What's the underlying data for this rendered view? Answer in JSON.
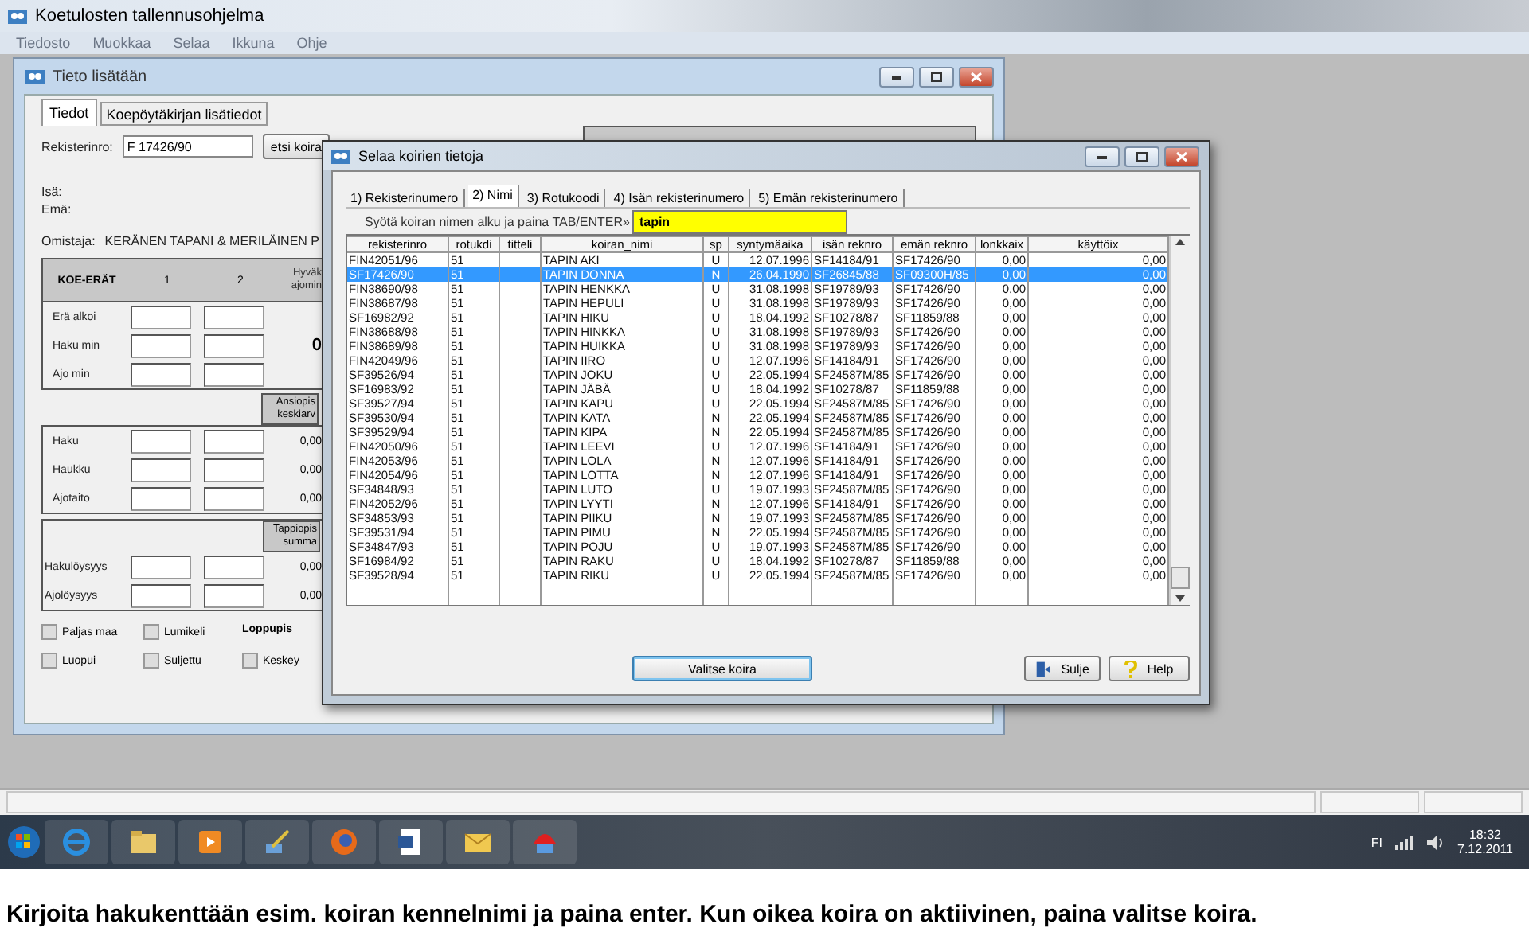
{
  "app": {
    "title": "Koetulosten tallennusohjelma",
    "menu": [
      "Tiedosto",
      "Muokkaa",
      "Selaa",
      "Ikkuna",
      "Ohje"
    ]
  },
  "form_window": {
    "title": "Tieto lisätään",
    "tabs": [
      {
        "label": "Tiedot",
        "selected": true
      },
      {
        "label": "Koepöytäkirjan lisätiedot",
        "selected": false
      }
    ],
    "reg_label": "Rekisterinro:",
    "reg_value": "F 17426/90",
    "find_button": "etsi koira",
    "sire_label": "Isä:",
    "dam_label": "Emä:",
    "owner_label": "Omistaja:",
    "owner": "KERÄNEN TAPANI & MERILÄINEN P",
    "trials": {
      "header": [
        "KOE-ERÄT",
        "1",
        "2"
      ],
      "side_header": [
        "Hyväk",
        "ajomin"
      ],
      "total": "0",
      "rows": [
        "Erä alkoi",
        "Haku min",
        "Ajo min"
      ]
    },
    "merit": {
      "header": [
        "Ansiopis",
        "keskiarv"
      ],
      "rows": [
        {
          "label": "Haku",
          "value": "0,00"
        },
        {
          "label": "Haukku",
          "value": "0,00"
        },
        {
          "label": "Ajotaito",
          "value": "0,00"
        }
      ]
    },
    "penalty": {
      "header": [
        "Tappiopis",
        "summa"
      ],
      "rows": [
        {
          "label": "Hakulöysyys",
          "value": "0,00"
        },
        {
          "label": "Ajolöysyys",
          "value": "0,00"
        }
      ]
    },
    "options": [
      {
        "kind": "checkbox",
        "label": "Paljas maa",
        "checked": false
      },
      {
        "kind": "checkbox",
        "label": "Lumikeli",
        "checked": false
      },
      {
        "kind": "heading",
        "label": "Loppupis"
      },
      {
        "kind": "checkbox",
        "label": "Luopui",
        "checked": false
      },
      {
        "kind": "checkbox",
        "label": "Suljettu",
        "checked": false
      },
      {
        "kind": "checkbox",
        "label": "Keskey",
        "checked": false
      }
    ]
  },
  "dialog": {
    "title": "Selaa koirien tietoja",
    "tabs": [
      {
        "label": "1) Rekisterinumero",
        "selected": false
      },
      {
        "label": "2) Nimi",
        "selected": true
      },
      {
        "label": "3) Rotukoodi",
        "selected": false
      },
      {
        "label": "4) Isän rekisterinumero",
        "selected": false
      },
      {
        "label": "5) Emän rekisterinumero",
        "selected": false
      }
    ],
    "search": {
      "label": "Syötä koiran nimen alku ja paina TAB/ENTER»",
      "value": "tapin"
    },
    "columns": [
      "rekisterinro",
      "rotukdi",
      "titteli",
      "koiran_nimi",
      "sp",
      "syntymäaika",
      "isän reknro",
      "emän reknro",
      "lonkkaix",
      "käyttöix"
    ],
    "rows": [
      {
        "selected": false,
        "reg": "FIN42051/96",
        "breed": "51",
        "name": "TAPIN AKI",
        "sex": "U",
        "born": "12.07.1996",
        "sire": "SF14184/91",
        "dam": "SF17426/90",
        "hip": "0,00",
        "use": "0,00"
      },
      {
        "selected": true,
        "reg": "SF17426/90",
        "breed": "51",
        "name": "TAPIN DONNA",
        "sex": "N",
        "born": "26.04.1990",
        "sire": "SF26845/88",
        "dam": "SF09300H/85",
        "hip": "0,00",
        "use": "0,00"
      },
      {
        "selected": false,
        "reg": "FIN38690/98",
        "breed": "51",
        "name": "TAPIN HENKKA",
        "sex": "U",
        "born": "31.08.1998",
        "sire": "SF19789/93",
        "dam": "SF17426/90",
        "hip": "0,00",
        "use": "0,00"
      },
      {
        "selected": false,
        "reg": "FIN38687/98",
        "breed": "51",
        "name": "TAPIN HEPULI",
        "sex": "U",
        "born": "31.08.1998",
        "sire": "SF19789/93",
        "dam": "SF17426/90",
        "hip": "0,00",
        "use": "0,00"
      },
      {
        "selected": false,
        "reg": "SF16982/92",
        "breed": "51",
        "name": "TAPIN HIKU",
        "sex": "U",
        "born": "18.04.1992",
        "sire": "SF10278/87",
        "dam": "SF11859/88",
        "hip": "0,00",
        "use": "0,00"
      },
      {
        "selected": false,
        "reg": "FIN38688/98",
        "breed": "51",
        "name": "TAPIN HINKKA",
        "sex": "U",
        "born": "31.08.1998",
        "sire": "SF19789/93",
        "dam": "SF17426/90",
        "hip": "0,00",
        "use": "0,00"
      },
      {
        "selected": false,
        "reg": "FIN38689/98",
        "breed": "51",
        "name": "TAPIN HUIKKA",
        "sex": "U",
        "born": "31.08.1998",
        "sire": "SF19789/93",
        "dam": "SF17426/90",
        "hip": "0,00",
        "use": "0,00"
      },
      {
        "selected": false,
        "reg": "FIN42049/96",
        "breed": "51",
        "name": "TAPIN IIRO",
        "sex": "U",
        "born": "12.07.1996",
        "sire": "SF14184/91",
        "dam": "SF17426/90",
        "hip": "0,00",
        "use": "0,00"
      },
      {
        "selected": false,
        "reg": "SF39526/94",
        "breed": "51",
        "name": "TAPIN JOKU",
        "sex": "U",
        "born": "22.05.1994",
        "sire": "SF24587M/85",
        "dam": "SF17426/90",
        "hip": "0,00",
        "use": "0,00"
      },
      {
        "selected": false,
        "reg": "SF16983/92",
        "breed": "51",
        "name": "TAPIN JÄBÄ",
        "sex": "U",
        "born": "18.04.1992",
        "sire": "SF10278/87",
        "dam": "SF11859/88",
        "hip": "0,00",
        "use": "0,00"
      },
      {
        "selected": false,
        "reg": "SF39527/94",
        "breed": "51",
        "name": "TAPIN KAPU",
        "sex": "U",
        "born": "22.05.1994",
        "sire": "SF24587M/85",
        "dam": "SF17426/90",
        "hip": "0,00",
        "use": "0,00"
      },
      {
        "selected": false,
        "reg": "SF39530/94",
        "breed": "51",
        "name": "TAPIN KATA",
        "sex": "N",
        "born": "22.05.1994",
        "sire": "SF24587M/85",
        "dam": "SF17426/90",
        "hip": "0,00",
        "use": "0,00"
      },
      {
        "selected": false,
        "reg": "SF39529/94",
        "breed": "51",
        "name": "TAPIN KIPA",
        "sex": "N",
        "born": "22.05.1994",
        "sire": "SF24587M/85",
        "dam": "SF17426/90",
        "hip": "0,00",
        "use": "0,00"
      },
      {
        "selected": false,
        "reg": "FIN42050/96",
        "breed": "51",
        "name": "TAPIN LEEVI",
        "sex": "U",
        "born": "12.07.1996",
        "sire": "SF14184/91",
        "dam": "SF17426/90",
        "hip": "0,00",
        "use": "0,00"
      },
      {
        "selected": false,
        "reg": "FIN42053/96",
        "breed": "51",
        "name": "TAPIN LOLA",
        "sex": "N",
        "born": "12.07.1996",
        "sire": "SF14184/91",
        "dam": "SF17426/90",
        "hip": "0,00",
        "use": "0,00"
      },
      {
        "selected": false,
        "reg": "FIN42054/96",
        "breed": "51",
        "name": "TAPIN LOTTA",
        "sex": "N",
        "born": "12.07.1996",
        "sire": "SF14184/91",
        "dam": "SF17426/90",
        "hip": "0,00",
        "use": "0,00"
      },
      {
        "selected": false,
        "reg": "SF34848/93",
        "breed": "51",
        "name": "TAPIN LUTO",
        "sex": "U",
        "born": "19.07.1993",
        "sire": "SF24587M/85",
        "dam": "SF17426/90",
        "hip": "0,00",
        "use": "0,00"
      },
      {
        "selected": false,
        "reg": "FIN42052/96",
        "breed": "51",
        "name": "TAPIN LYYTI",
        "sex": "N",
        "born": "12.07.1996",
        "sire": "SF14184/91",
        "dam": "SF17426/90",
        "hip": "0,00",
        "use": "0,00"
      },
      {
        "selected": false,
        "reg": "SF34853/93",
        "breed": "51",
        "name": "TAPIN PIIKU",
        "sex": "N",
        "born": "19.07.1993",
        "sire": "SF24587M/85",
        "dam": "SF17426/90",
        "hip": "0,00",
        "use": "0,00"
      },
      {
        "selected": false,
        "reg": "SF39531/94",
        "breed": "51",
        "name": "TAPIN PIMU",
        "sex": "N",
        "born": "22.05.1994",
        "sire": "SF24587M/85",
        "dam": "SF17426/90",
        "hip": "0,00",
        "use": "0,00"
      },
      {
        "selected": false,
        "reg": "SF34847/93",
        "breed": "51",
        "name": "TAPIN POJU",
        "sex": "U",
        "born": "19.07.1993",
        "sire": "SF24587M/85",
        "dam": "SF17426/90",
        "hip": "0,00",
        "use": "0,00"
      },
      {
        "selected": false,
        "reg": "SF16984/92",
        "breed": "51",
        "name": "TAPIN RAKU",
        "sex": "U",
        "born": "18.04.1992",
        "sire": "SF10278/87",
        "dam": "SF11859/88",
        "hip": "0,00",
        "use": "0,00"
      },
      {
        "selected": false,
        "reg": "SF39528/94",
        "breed": "51",
        "name": "TAPIN RIKU",
        "sex": "U",
        "born": "22.05.1994",
        "sire": "SF24587M/85",
        "dam": "SF17426/90",
        "hip": "0,00",
        "use": "0,00"
      }
    ],
    "buttons": [
      {
        "kind": "select",
        "label": "Valitse koira"
      },
      {
        "kind": "close",
        "label": "Sulje"
      },
      {
        "kind": "help",
        "label": "Help"
      }
    ]
  },
  "taskbar": {
    "apps": [
      {
        "kind": "start"
      },
      {
        "kind": "browser"
      },
      {
        "kind": "folder"
      },
      {
        "kind": "media"
      },
      {
        "kind": "paint"
      },
      {
        "kind": "firefox"
      },
      {
        "kind": "word"
      },
      {
        "kind": "mail"
      },
      {
        "kind": "smurf"
      }
    ],
    "language": "FI",
    "time": "18:32",
    "date": "7.12.2011"
  },
  "caption": "Kirjoita hakukenttään esim. koiran kennelnimi ja paina enter. Kun oikea koira on aktiivinen, paina valitse koira."
}
